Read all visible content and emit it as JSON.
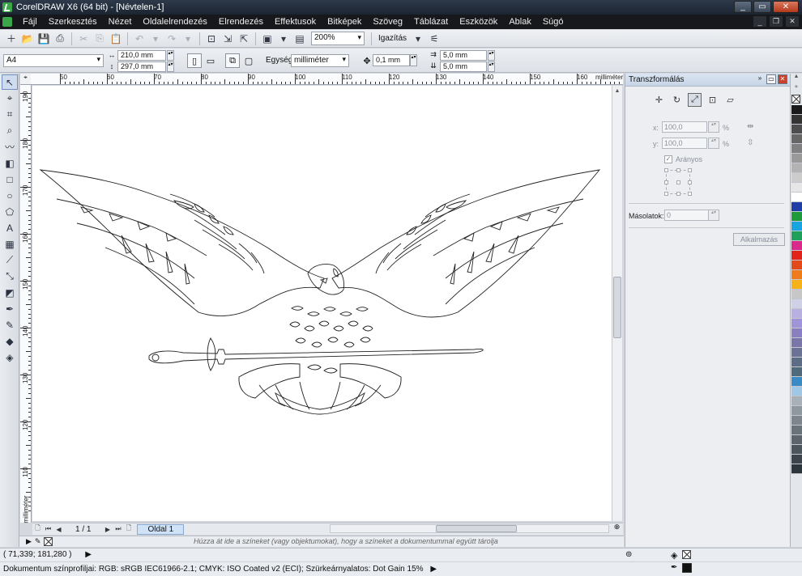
{
  "window": {
    "title": "CorelDRAW X6 (64 bit) - [Névtelen-1]"
  },
  "menu": [
    "Fájl",
    "Szerkesztés",
    "Nézet",
    "Oldalelrendezés",
    "Elrendezés",
    "Effektusok",
    "Bitképek",
    "Szöveg",
    "Táblázat",
    "Eszközök",
    "Ablak",
    "Súgó"
  ],
  "toolbar": {
    "zoom": "200%",
    "snap_label": "Igazítás"
  },
  "propbar": {
    "page_size": "A4",
    "width": "210,0 mm",
    "height": "297,0 mm",
    "unit_label": "Egység:",
    "unit_value": "milliméter",
    "nudge": "0,1 mm",
    "dup_x": "5,0 mm",
    "dup_y": "5,0 mm"
  },
  "ruler": {
    "unit": "milliméter",
    "h_ticks": [
      "50",
      "60",
      "70",
      "80",
      "90",
      "100",
      "110",
      "120",
      "130",
      "140",
      "150",
      "160"
    ],
    "v_ticks": [
      "190",
      "180",
      "170",
      "160",
      "150",
      "140",
      "130",
      "120",
      "110"
    ],
    "v_unit": "milliméter"
  },
  "pagenav": {
    "count": "1 / 1",
    "page_tab": "Oldal 1"
  },
  "dropbar": {
    "hint": "Húzza át ide a színeket (vagy objektumokat), hogy a színeket a dokumentummal együtt tárolja"
  },
  "status": {
    "coords": "( 71,339; 181,280 )",
    "profile": "Dokumentum színprofiljai: RGB: sRGB IEC61966-2.1; CMYK: ISO Coated v2 (ECI); Szürkeárnyalatos: Dot Gain 15%"
  },
  "docker": {
    "title": "Transzformálás",
    "x_label": "x:",
    "x_value": "100,0",
    "y_label": "y:",
    "y_value": "100,0",
    "percent": "%",
    "proportional": "Arányos",
    "copies_label": "Másolatok:",
    "copies_value": "0",
    "apply": "Alkalmazás"
  },
  "palette": [
    "#1a1a1a",
    "#333333",
    "#4d4d4d",
    "#666666",
    "#808080",
    "#999999",
    "#b3b3b3",
    "#cccccc",
    "#e6e6e6",
    "#ffffff",
    "#1f3fa6",
    "#1f9a3a",
    "#17a5e0",
    "#1fa05a",
    "#d92a8c",
    "#e2231a",
    "#e24a1a",
    "#f07b1a",
    "#f7b21a",
    "#c7c7c7",
    "#d0d0e6",
    "#b7b0e0",
    "#9f94d6",
    "#8a80c0",
    "#7a76aa",
    "#6c7296",
    "#5d6d86",
    "#4f6a7a",
    "#3a8ac6",
    "#9fc7e6",
    "#a8b0b8",
    "#8f979f",
    "#7d858d",
    "#6a727a",
    "#5c646c",
    "#4c545c",
    "#3c444c",
    "#2c343c"
  ]
}
